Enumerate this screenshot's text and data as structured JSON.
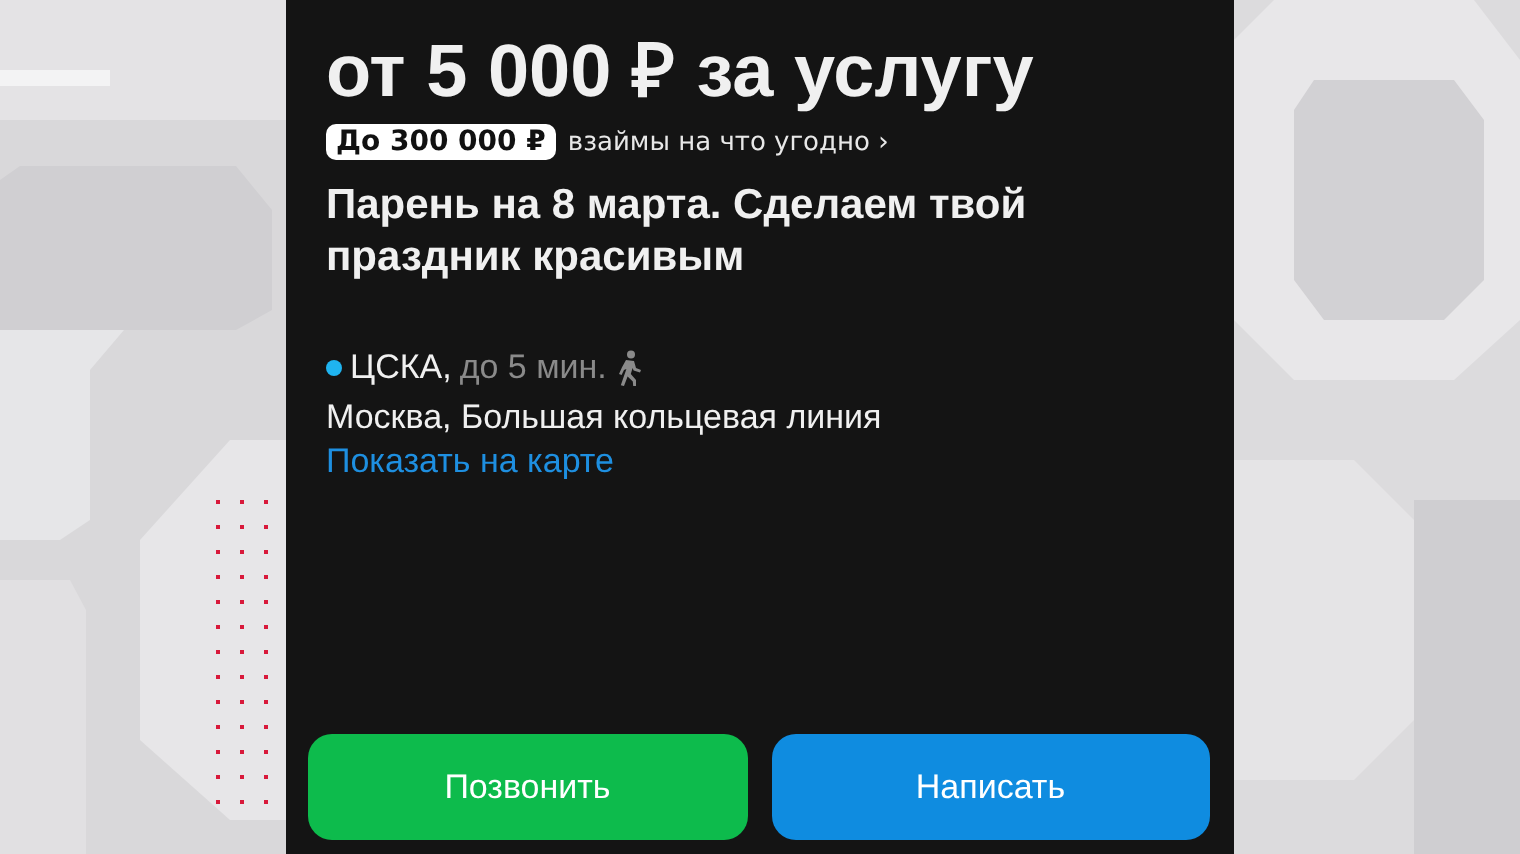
{
  "price": "от 5 000 ₽ за услугу",
  "loan": {
    "badge": "До 300 000 ₽",
    "text": "взаймы на что угодно",
    "arrow": "›"
  },
  "description": "Парень на 8 марта. Сделаем твой праздник красивым",
  "location": {
    "metro": "ЦСКА,",
    "distance": "до 5 мин.",
    "address": "Москва, Большая кольцевая линия",
    "map_link": "Показать на карте"
  },
  "buttons": [
    {
      "kind": "call",
      "label": "Позвонить"
    },
    {
      "kind": "message",
      "label": "Написать"
    }
  ]
}
